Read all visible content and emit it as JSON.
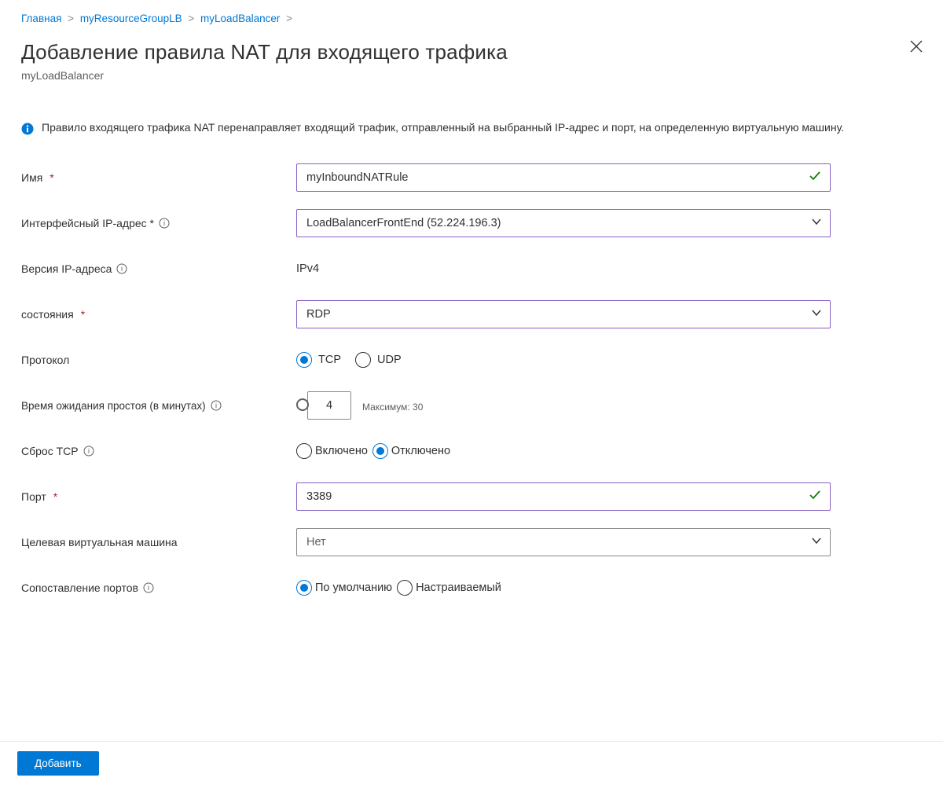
{
  "breadcrumb": {
    "home": "Главная",
    "group": "myResourceGroupLB",
    "resource": "myLoadBalancer"
  },
  "header": {
    "title": "Добавление правила NAT для входящего трафика",
    "subtitle": "myLoadBalancer"
  },
  "info": {
    "text": "Правило входящего трафика NAT перенаправляет входящий трафик, отправленный на выбранный IP-адрес и порт, на определенную виртуальную машину."
  },
  "form": {
    "name": {
      "label": "Имя",
      "value": "myInboundNATRule"
    },
    "frontend_ip": {
      "label": "Интерфейсный IP-адрес *",
      "value": "LoadBalancerFrontEnd (52.224.196.3)"
    },
    "ip_version": {
      "label": "Версия IP-адреса",
      "value": "IPv4"
    },
    "service": {
      "label": "состояния",
      "value": "RDP"
    },
    "protocol": {
      "label": "Протокол",
      "tcp": "TCP",
      "udp": "UDP"
    },
    "idle": {
      "label": "Время ожидания простоя (в минутах)",
      "value": "4",
      "hint": "Максимум: 30"
    },
    "tcp_reset": {
      "label": "Сброс TCP",
      "on": "Включено",
      "off": "Отключено"
    },
    "port": {
      "label": "Порт",
      "value": "3389"
    },
    "target_vm": {
      "label": "Целевая виртуальная машина",
      "value": "Нет"
    },
    "port_mapping": {
      "label": "Сопоставление портов",
      "default": "По умолчанию",
      "custom": "Настраиваемый"
    }
  },
  "footer": {
    "add": "Добавить"
  }
}
